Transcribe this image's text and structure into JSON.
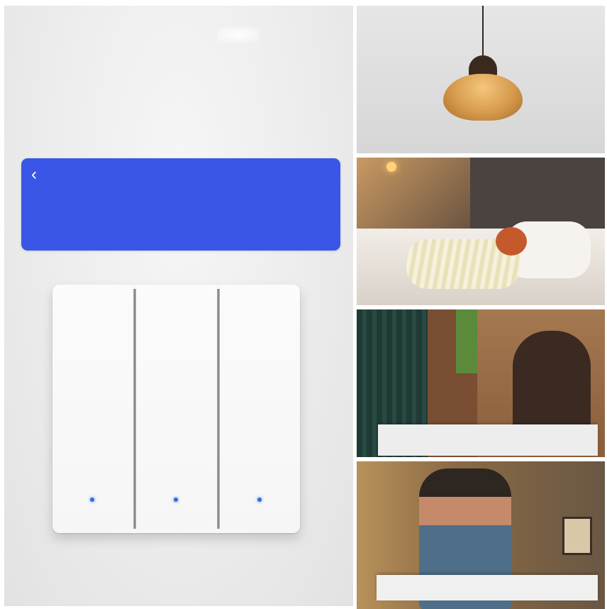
{
  "app_bar": {
    "back_icon": "chevron-left-icon",
    "title": "",
    "color": "#3a56e6"
  },
  "switch": {
    "gangs": 3,
    "led_color": "#2f6fe2"
  },
  "scenes": [
    {
      "name": "pendant-lamp-photo"
    },
    {
      "name": "bedroom-photo"
    },
    {
      "name": "doorway-photo"
    },
    {
      "name": "hallway-photo"
    }
  ]
}
